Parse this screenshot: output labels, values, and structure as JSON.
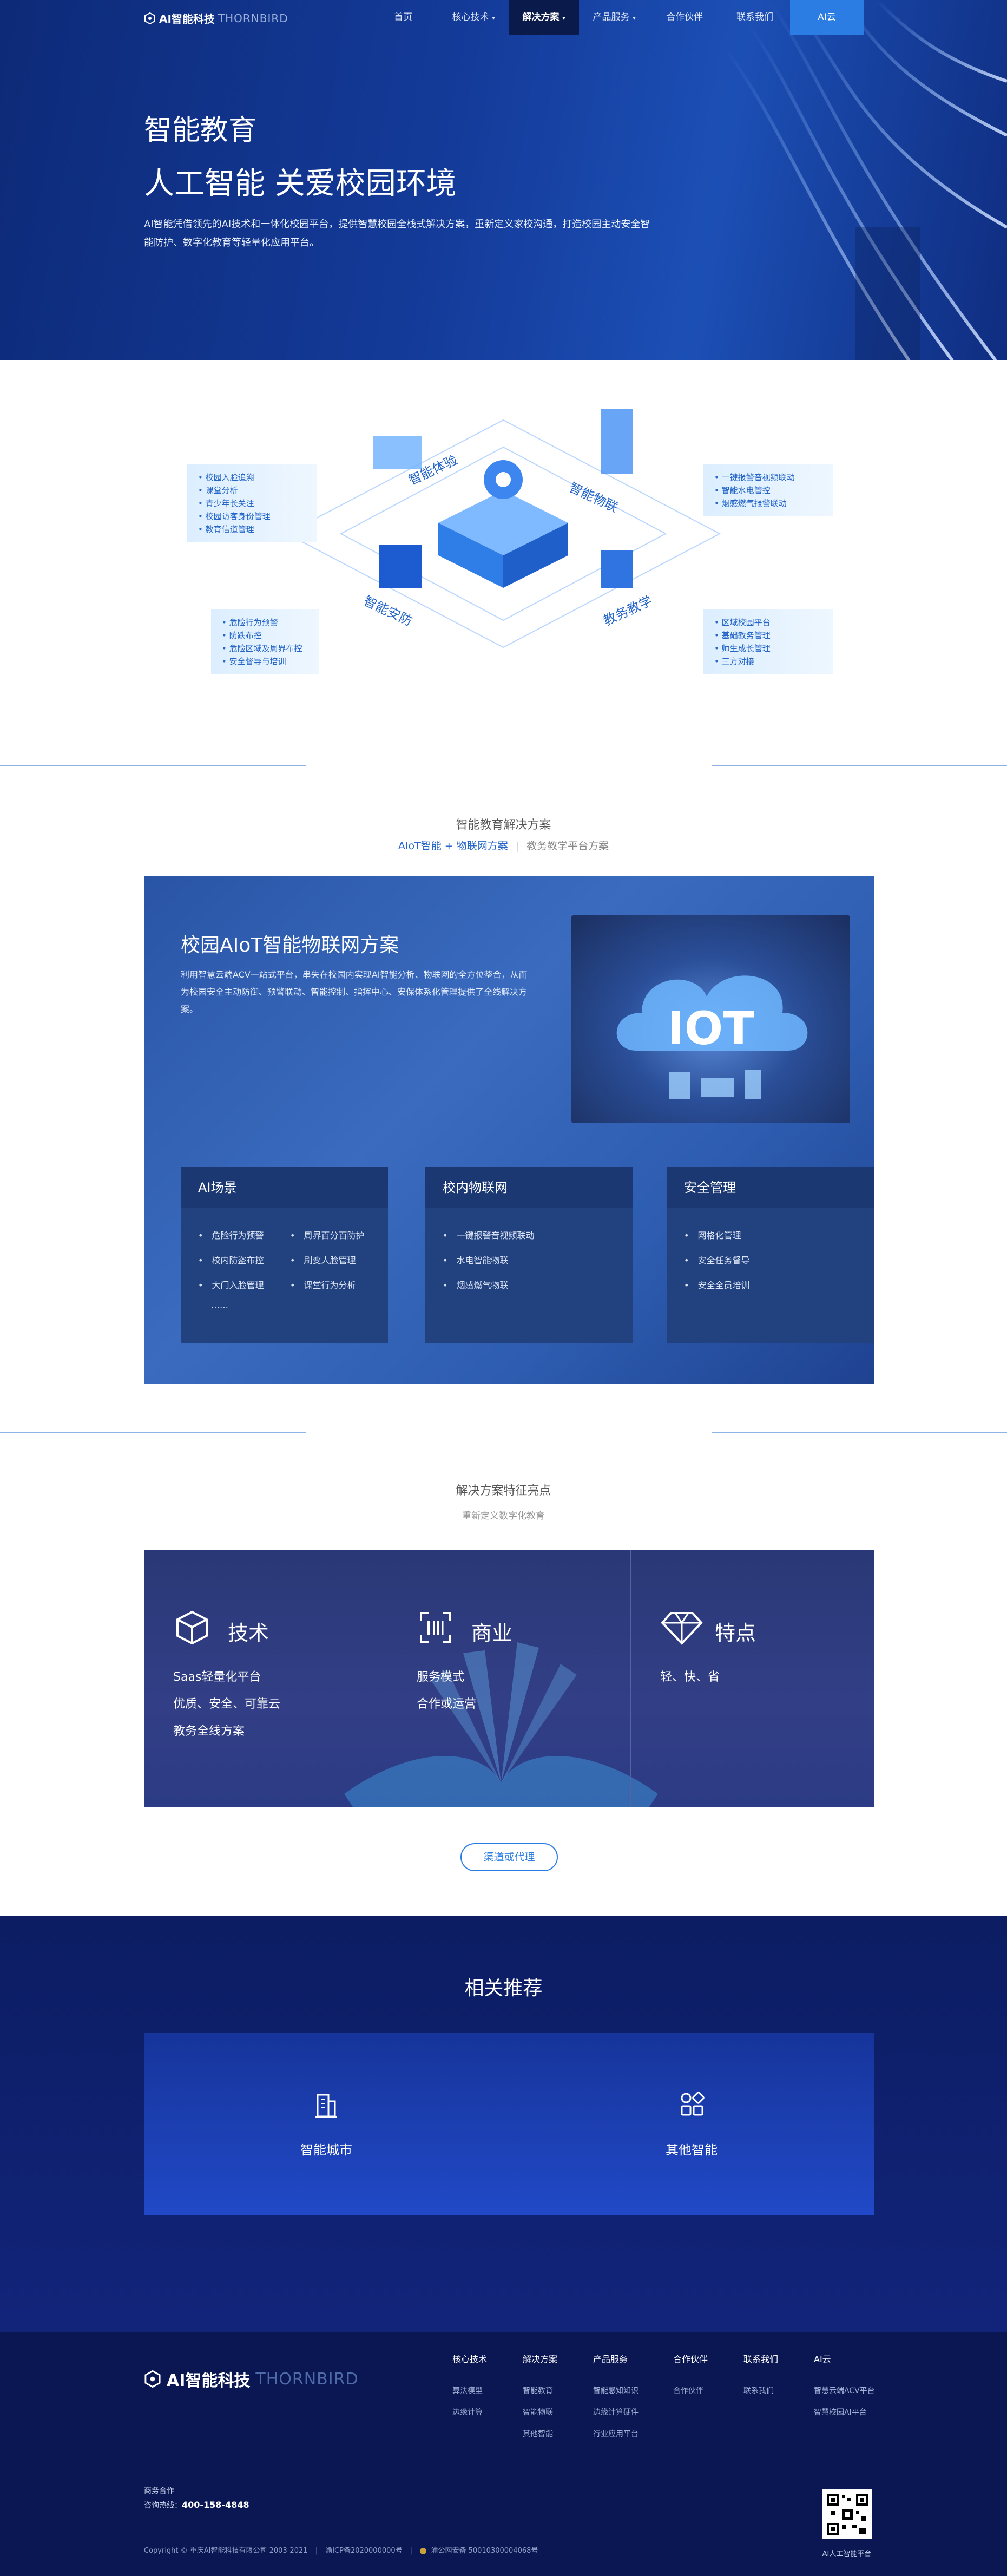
{
  "nav": {
    "logo_mark": "A I",
    "logo_name": "AI智能科技",
    "logo_en": "THORNBIRD",
    "items": [
      {
        "label": "首页",
        "dropdown": false
      },
      {
        "label": "核心技术",
        "dropdown": true
      },
      {
        "label": "解决方案",
        "dropdown": true
      },
      {
        "label": "产品服务",
        "dropdown": true
      },
      {
        "label": "合作伙伴",
        "dropdown": false
      },
      {
        "label": "联系我们",
        "dropdown": false
      },
      {
        "label": "AI云",
        "dropdown": false
      }
    ],
    "active_index": 2
  },
  "hero": {
    "title": "智能教育",
    "subtitle": "人工智能 关爱校园环境",
    "desc": "AI智能凭借领先的AI技术和一体化校园平台，提供智慧校园全栈式解决方案，重新定义家校沟通，打造校园主动安全智能防护、数字化教育等轻量化应用平台。"
  },
  "illustration": {
    "labels": {
      "experience": "智能体验",
      "iot": "智能物联",
      "security": "智能安防",
      "teaching": "教务教学"
    },
    "callout_tl": [
      "校园入脸追溯",
      "课堂分析",
      "青少年长关注",
      "校园访客身份管理",
      "教育信道管理"
    ],
    "callout_tr": [
      "一键报警音视频联动",
      "智能水电管控",
      "烟感燃气报警联动"
    ],
    "callout_bl": [
      "危险行为预警",
      "防跌布控",
      "危险区域及周界布控",
      "安全督导与培训"
    ],
    "callout_br": [
      "区域校园平台",
      "基础教务管理",
      "师生成长管理",
      "三方对接"
    ]
  },
  "solutions": {
    "section_title": "智能教育解决方案",
    "tabs": [
      "AIoT智能 + 物联网方案",
      "教务教学平台方案"
    ],
    "active_tab": 0,
    "box_title": "校园AIoT智能物联网方案",
    "box_desc": "利用智慧云端ACV一站式平台，串失在校园内实现AI智能分析、物联网的全方位整合，从而为校园安全主动防御、预警联动、智能控制、指挥中心、安保体系化管理提供了全线解决方案。",
    "iot_text": "IOT",
    "cards": [
      {
        "title": "AI场景",
        "items": [
          [
            "危险行为预警",
            "周界百分百防护"
          ],
          [
            "校内防盗布控",
            "刷变人脸管理"
          ],
          [
            "大门入脸管理",
            "课堂行为分析"
          ]
        ],
        "more": "……"
      },
      {
        "title": "校内物联网",
        "items": [
          [
            "一键报警音视频联动"
          ],
          [
            "水电智能物联"
          ],
          [
            "烟感燃气物联"
          ]
        ],
        "more": ""
      },
      {
        "title": "安全管理",
        "items": [
          [
            "网格化管理"
          ],
          [
            "安全任务督导"
          ],
          [
            "安全全员培训"
          ]
        ],
        "more": ""
      }
    ]
  },
  "features": {
    "title": "解决方案特征亮点",
    "subtitle": "重新定义数字化教育",
    "cols": [
      {
        "title": "技术",
        "icon": "cube-icon",
        "lines": [
          "Saas轻量化平台",
          "优质、安全、可靠云",
          "教务全线方案"
        ]
      },
      {
        "title": "商业",
        "icon": "scan-icon",
        "lines": [
          "服务模式",
          "合作或运营"
        ]
      },
      {
        "title": "特点",
        "icon": "diamond-icon",
        "lines": [
          "轻、快、省"
        ]
      }
    ],
    "button": "渠道或代理"
  },
  "related": {
    "title": "相关推荐",
    "cards": [
      {
        "label": "智能城市",
        "icon": "building-icon"
      },
      {
        "label": "其他智能",
        "icon": "apps-icon"
      }
    ]
  },
  "footer": {
    "logo_name": "AI智能科技",
    "logo_en": "THORNBIRD",
    "columns": [
      {
        "head": "核心技术",
        "items": [
          "算法模型",
          "边缘计算"
        ]
      },
      {
        "head": "解决方案",
        "items": [
          "智能教育",
          "智能物联",
          "其他智能"
        ]
      },
      {
        "head": "产品服务",
        "items": [
          "智能感知知识",
          "边缘计算硬件",
          "行业应用平台"
        ]
      },
      {
        "head": "合作伙伴",
        "items": [
          "合作伙伴"
        ]
      },
      {
        "head": "联系我们",
        "items": [
          "联系我们"
        ]
      },
      {
        "head": "AI云",
        "items": [
          "智慧云端ACV平台",
          "智慧校园AI平台"
        ]
      }
    ],
    "business": "商务合作",
    "hotline_label": "咨询热线：",
    "hotline": "400-158-4848",
    "copyright": "Copyright © 重庆AI智能科技有限公司 2003-2021",
    "icp": "渝ICP备2020000000号",
    "police": "渝公网安备 50010300004068号",
    "qr_label": "AI人工智能平台"
  },
  "colors": {
    "primary": "#2b7de3",
    "navy": "#0c1d63",
    "hero": "#143b9a"
  }
}
